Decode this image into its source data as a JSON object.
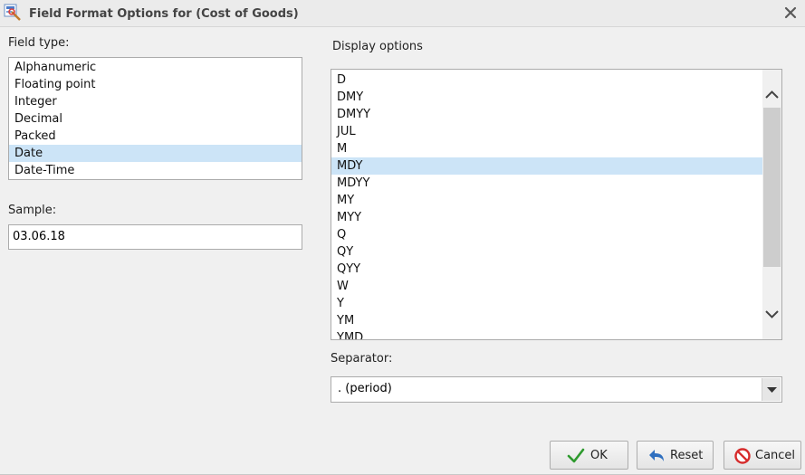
{
  "window": {
    "title": "Field Format Options for (Cost of Goods)",
    "icon": "field-format-icon",
    "close_icon": "close-icon"
  },
  "field_type": {
    "label": "Field type:",
    "items": [
      "Alphanumeric",
      "Floating point",
      "Integer",
      "Decimal",
      "Packed",
      "Date",
      "Date-Time"
    ],
    "selected": "Date"
  },
  "sample": {
    "label": "Sample:",
    "value": "03.06.18"
  },
  "display_options": {
    "label": "Display options",
    "items": [
      "D",
      "DMY",
      "DMYY",
      "JUL",
      "M",
      "MDY",
      "MDYY",
      "MY",
      "MYY",
      "Q",
      "QY",
      "QYY",
      "W",
      "Y",
      "YM",
      "YMD"
    ],
    "selected": "MDY"
  },
  "separator": {
    "label": "Separator:",
    "value": ". (period)"
  },
  "buttons": {
    "ok": "OK",
    "reset": "Reset",
    "cancel": "Cancel"
  },
  "colors": {
    "selection": "#cce4f7",
    "ok_check": "#2e9a2e",
    "reset_arrow": "#2f6fbf",
    "cancel_red": "#d62b2b"
  }
}
